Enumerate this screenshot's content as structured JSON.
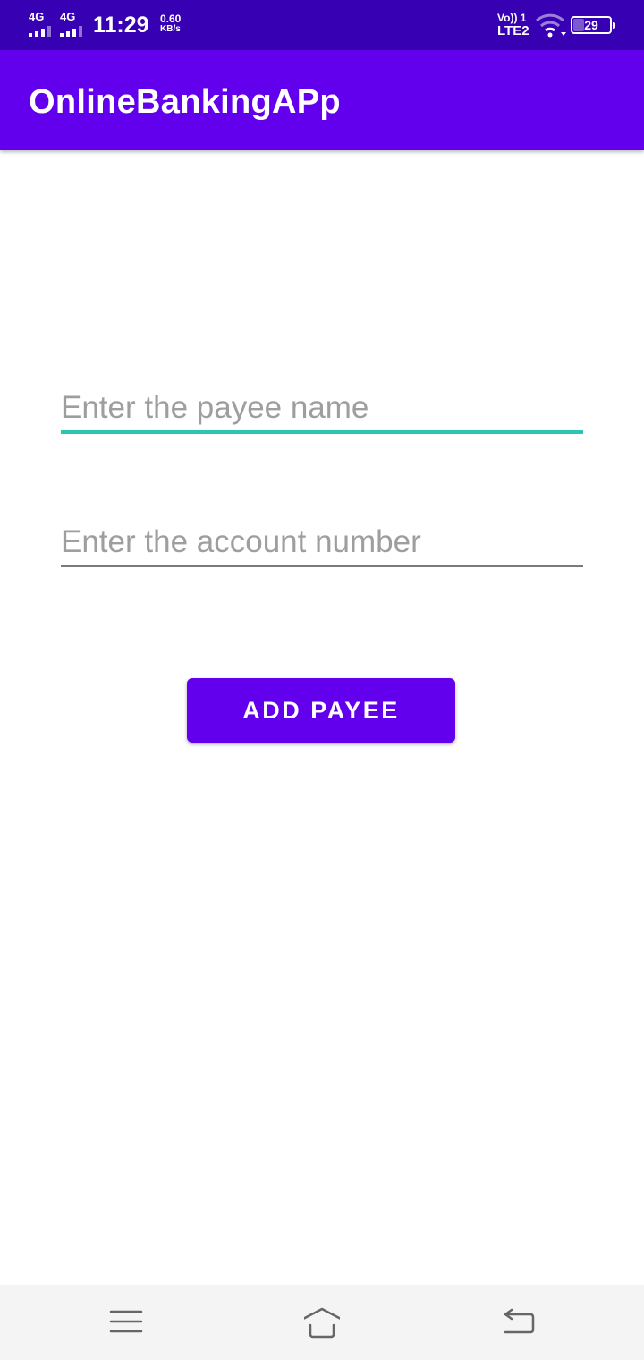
{
  "status_bar": {
    "sim1_network": "4G",
    "sim2_network": "4G",
    "time": "11:29",
    "speed_value": "0.60",
    "speed_unit": "KB/s",
    "volte": "Vo)) 1",
    "lte": "LTE2",
    "battery_level": "29",
    "icons": [
      "signal-icon",
      "signal-icon",
      "wifi-icon",
      "battery-icon"
    ]
  },
  "app_bar": {
    "title": "OnlineBankingAPp",
    "color": "#6200ee"
  },
  "form": {
    "payee_name": {
      "placeholder": "Enter the payee name",
      "value": "",
      "focused": true,
      "accent_color": "#2bc4b5"
    },
    "account_number": {
      "placeholder": "Enter the account number",
      "value": "",
      "focused": false
    },
    "add_button_label": "ADD PAYEE"
  },
  "nav_bar": {
    "buttons": [
      "menu-icon",
      "home-icon",
      "back-icon"
    ]
  },
  "colors": {
    "status_bar": "#3700b3",
    "primary": "#6200ee",
    "accent": "#2bc4b5"
  }
}
